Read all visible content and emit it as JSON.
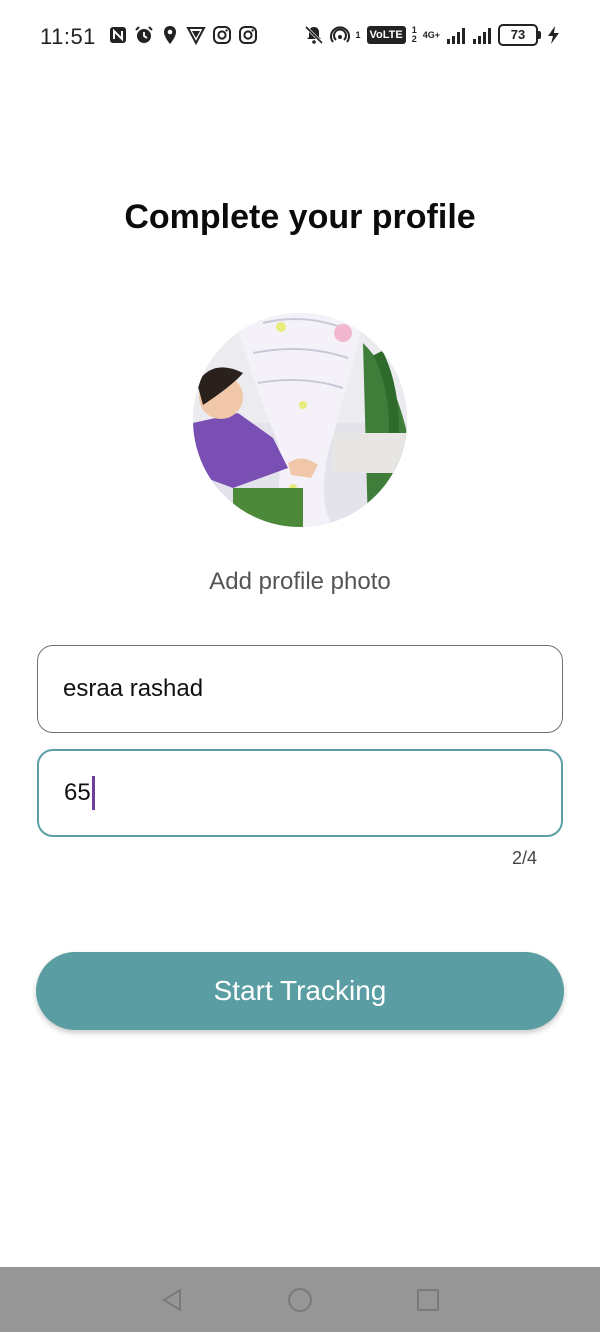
{
  "status_bar": {
    "time": "11:51",
    "volte": "VoLTE",
    "network_type": "4G+",
    "sim_slot_1": "1",
    "sim_slot_2": "2",
    "hotspot_badge": "1",
    "battery": "73"
  },
  "title": "Complete your profile",
  "profile": {
    "add_photo_label": "Add profile photo"
  },
  "form": {
    "name_value": "esraa rashad",
    "age_value": "65",
    "step_counter": "2/4"
  },
  "actions": {
    "start_label": "Start Tracking"
  },
  "colors": {
    "accent": "#5a9ea3",
    "focus_border": "#5a9fa3",
    "cursor": "#6b3fa0",
    "nav_bar": "#969696"
  },
  "icons": {
    "status_left": [
      "nfc-icon",
      "alarm-icon",
      "location-icon",
      "vpn-icon",
      "instagram-icon",
      "instagram-icon"
    ],
    "status_right": [
      "mute-icon",
      "hotspot-icon",
      "volte-icon",
      "signal-icon",
      "signal-icon",
      "battery-icon",
      "charging-icon"
    ],
    "nav": [
      "back-icon",
      "home-icon",
      "recents-icon"
    ]
  }
}
